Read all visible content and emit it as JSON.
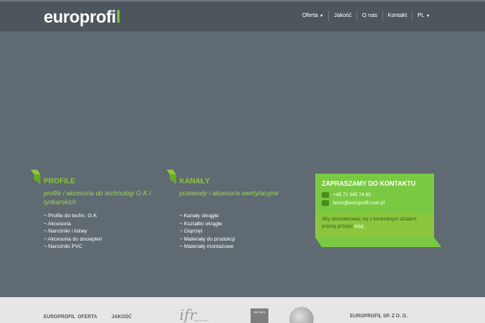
{
  "header": {
    "logo_main": "europrofi",
    "logo_accent": "l",
    "nav": [
      {
        "label": "Oferta",
        "dropdown": true
      },
      {
        "label": "Jakość",
        "dropdown": false
      },
      {
        "label": "O nas",
        "dropdown": false
      },
      {
        "label": "Kontakt",
        "dropdown": false
      },
      {
        "label": "PL",
        "dropdown": true
      }
    ]
  },
  "sections": {
    "profile": {
      "title": "PROFILE",
      "subtitle": "profile i akcesoria do technologi G-K i tynkarskich",
      "items": [
        "¬ Profile do techn. G-K",
        "¬ Akcesoria",
        "¬ Narożniki i listwy",
        "¬ Akcesoria do dociepleń",
        "¬ Narożniki PVC"
      ]
    },
    "kanaly": {
      "title": "KANAŁY",
      "subtitle": "przewody i akcesoria wentylacyjne",
      "items": [
        "¬ Kanały okrągłe",
        "¬ Kształtki okrągłe",
        "¬ Osprzęt",
        "¬ Materiały do produkcji",
        "¬ Materiały montażowe"
      ]
    }
  },
  "contact": {
    "title": "ZAPRASZAMY DO KONTAKTU",
    "phone": "+48 71 345 74 80",
    "email": "biuro@europrofil.com.pl",
    "note": "Aby skontaktować się z konkretnym działem proszę przejść",
    "note_link": "tutaj"
  },
  "footer": {
    "links": [
      "EUROPROFIL",
      "OFERTA",
      "JAKOŚĆ"
    ],
    "ifr_logo": "ifr",
    "ifr_sub": "INICJATYWA",
    "iso_text": "ISO 9001",
    "company": "EUROPROFIL SP. Z O. O."
  },
  "colors": {
    "background": "#5f6a72",
    "topbar": "#4d565d",
    "accent_green": "#7ac943",
    "light_green": "#8cc63f",
    "footer": "#e6e6e6"
  }
}
